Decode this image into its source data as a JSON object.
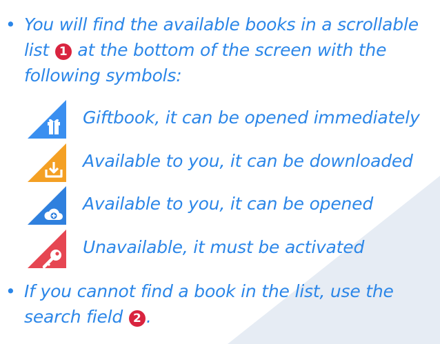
{
  "colors": {
    "text": "#2b86e8",
    "badge": "#d9243f",
    "gift": "#3a8ff0",
    "download": "#f4a024",
    "open": "#2f80de",
    "locked": "#e64652"
  },
  "bullets": [
    {
      "symbol": "•",
      "before_badge": "You will find the available books in a scrollable list",
      "badge": "1",
      "after_badge": " at the bottom of the screen with the following symbols:"
    },
    {
      "symbol": "•",
      "before_badge": "If you cannot find a book in the list, use the search field",
      "badge": "2",
      "after_badge": "."
    }
  ],
  "legend": [
    {
      "icon": "gift-icon",
      "label": "Giftbook, it can be opened immediately"
    },
    {
      "icon": "download-icon",
      "label": "Available to you, it can be downloaded"
    },
    {
      "icon": "cloud-plus-icon",
      "label": "Available to you, it can be opened"
    },
    {
      "icon": "key-icon",
      "label": "Unavailable, it must be activated"
    }
  ]
}
